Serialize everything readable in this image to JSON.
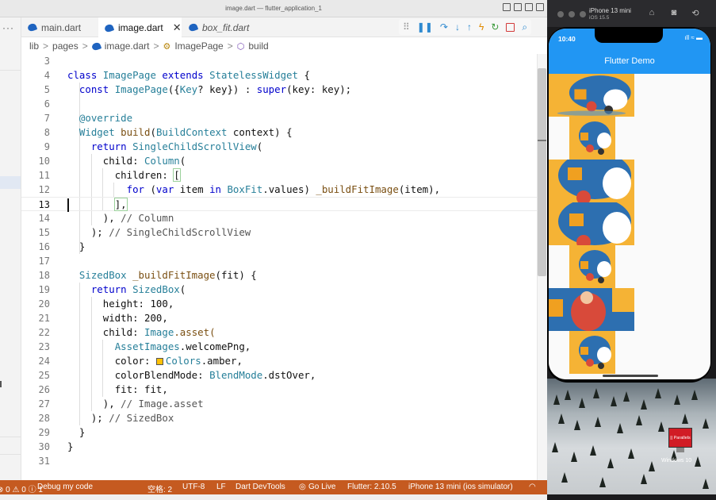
{
  "window": {
    "title": "image.dart — flutter_application_1"
  },
  "sidebar": {
    "overflow": "···"
  },
  "tabs": [
    {
      "label": "main.dart",
      "active": false
    },
    {
      "label": "image.dart",
      "active": true,
      "close": "✕"
    },
    {
      "label": "box_fit.dart",
      "active": false
    }
  ],
  "debug_toolbar": {
    "grip": "⠿",
    "pause": "❚❚",
    "step_over": "↷",
    "step_into": "↓",
    "step_out": "↑",
    "hot_reload": "ϟ",
    "restart": "↻",
    "stop": "",
    "inspect": "⌕"
  },
  "breadcrumb": {
    "segments": [
      "lib",
      "pages",
      "image.dart",
      "ImagePage",
      "build"
    ],
    "sep": ">"
  },
  "code": {
    "lines": [
      {
        "n": "3"
      },
      {
        "n": "4"
      },
      {
        "n": "5"
      },
      {
        "n": "6"
      },
      {
        "n": "7"
      },
      {
        "n": "8"
      },
      {
        "n": "9"
      },
      {
        "n": "10"
      },
      {
        "n": "11"
      },
      {
        "n": "12"
      },
      {
        "n": "13"
      },
      {
        "n": "14"
      },
      {
        "n": "15"
      },
      {
        "n": "16"
      },
      {
        "n": "17"
      },
      {
        "n": "18"
      },
      {
        "n": "19"
      },
      {
        "n": "20"
      },
      {
        "n": "21"
      },
      {
        "n": "22"
      },
      {
        "n": "23"
      },
      {
        "n": "24"
      },
      {
        "n": "25"
      },
      {
        "n": "26"
      },
      {
        "n": "27"
      },
      {
        "n": "28"
      },
      {
        "n": "29"
      },
      {
        "n": "30"
      },
      {
        "n": "31"
      }
    ],
    "t": {
      "class": "class",
      "ImagePage": "ImagePage",
      "extends": "extends",
      "StatelessWidget": "StatelessWidget",
      "lbrace": " {",
      "const": "const",
      "ctor": "ImagePage",
      "ctor_args_a": "({",
      "Key": "Key",
      "ctor_args_b": "? key}) : ",
      "super": "super",
      "ctor_args_c": "(key: key);",
      "override": "@override",
      "Widget": "Widget",
      "build": "build",
      "build_args_a": "(",
      "BuildContext": "BuildContext",
      "build_args_b": " context) {",
      "return": "return",
      "SingleChildScrollView": "SingleChildScrollView",
      "open": "(",
      "child": "child:",
      "Column": "Column",
      "children": "children:",
      "lbracket": "[",
      "for": "for",
      "for_a": " (",
      "var": "var",
      "for_b": " item ",
      "in": "in",
      "BoxFit": "BoxFit",
      "for_c": ".values) ",
      "buildFitImage": "_buildFitImage",
      "for_d": "(item),",
      "close_list": "],",
      "close_col": "), ",
      "cm_column": "// Column",
      "close_scroll": "); ",
      "cm_scroll": "// SingleChildScrollView",
      "rbrace": "}",
      "SizedBox": "SizedBox",
      "bfi_a": " ",
      "bfi_name": "_buildFitImage",
      "bfi_b": "(fit) {",
      "return2": "return",
      "SizedBox2": "SizedBox",
      "open2": "(",
      "height": "height:",
      "h_val": " 100,",
      "width": "width:",
      "w_val": " 200,",
      "child2": "child:",
      "Image": "Image",
      "asset": ".asset(",
      "AssetImages": "AssetImages",
      "welcome": ".welcomePng,",
      "color": "color:",
      "Colors": "Colors",
      "amber": ".amber,",
      "colorBlendMode": "colorBlendMode:",
      "BlendMode": "BlendMode",
      "dstOver": ".dstOver,",
      "fit": "fit:",
      "fit_val": " fit,",
      "close_img": "), ",
      "cm_img": "// Image.asset",
      "close_sb": "); ",
      "cm_sb": "// SizedBox",
      "rbrace2": "}",
      "rbrace3": "}"
    }
  },
  "statusbar": {
    "problems": "⊗ 0 ⚠ 0 ⓘ 1",
    "debug": "Debug my code",
    "spaces": "空格: 2",
    "encoding": "UTF-8",
    "eol": "LF",
    "devtools": "Dart DevTools",
    "golive": "Go Live",
    "flutter": "Flutter: 2.10.5",
    "device": "iPhone 13 mini (ios simulator)",
    "bell": "◠"
  },
  "simulator": {
    "name": "iPhone 13 mini",
    "os": "iOS 15.5",
    "time": "10:40",
    "signal": "ıll ≈ ▬",
    "app_title": "Flutter Demo",
    "desktop_icon_label": "Windows 10",
    "desktop_icon_brand": "|| Parallels"
  },
  "colors": {
    "status_bar": "#c55a20",
    "app_bar": "#2196f3",
    "amber": "#ffc107",
    "accent": "#2f8ad0"
  }
}
